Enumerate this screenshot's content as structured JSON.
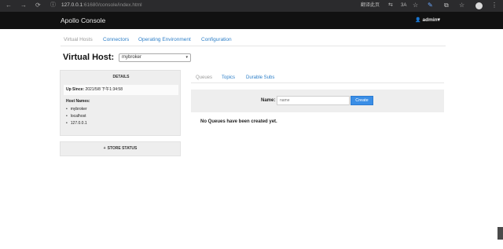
{
  "browser": {
    "back_glyph": "←",
    "forward_glyph": "→",
    "reload_glyph": "⟳",
    "info_glyph": "ⓘ",
    "url_host": "127.0.0.1",
    "url_rest": ":61680/console/index.html",
    "right_text_1": "翻译此页",
    "right_glyph_1": "⇆",
    "right_text_2": "3A",
    "right_glyph_2": "☆",
    "right_glyph_3": "⧉",
    "menu_glyph": "⋮"
  },
  "app": {
    "brand": "Apollo Console",
    "user_icon": "👤",
    "user": "admin",
    "user_caret": "▾"
  },
  "top_tabs": [
    {
      "label": "Virtual Hosts"
    },
    {
      "label": "Connectors"
    },
    {
      "label": "Operating Environment"
    },
    {
      "label": "Configuration"
    }
  ],
  "virtual_host": {
    "label": "Virtual Host:",
    "selected": "mybroker",
    "caret": "▾"
  },
  "details": {
    "header": "DETAILS",
    "up_since_label": "Up Since:",
    "up_since_value": "2021/5/8 下午1:34:58",
    "host_names_label": "Host Names:",
    "host_names": [
      "mybroker",
      "localhost",
      "127.0.0.1"
    ]
  },
  "store_status": {
    "plus": "+",
    "label": "STORE STATUS"
  },
  "sub_tabs": [
    {
      "label": "Queues"
    },
    {
      "label": "Topics"
    },
    {
      "label": "Durable Subs"
    }
  ],
  "queue_form": {
    "name_label": "Name:",
    "name_placeholder": "name",
    "create_label": "Create"
  },
  "empty_message": "No Queues have been created yet."
}
